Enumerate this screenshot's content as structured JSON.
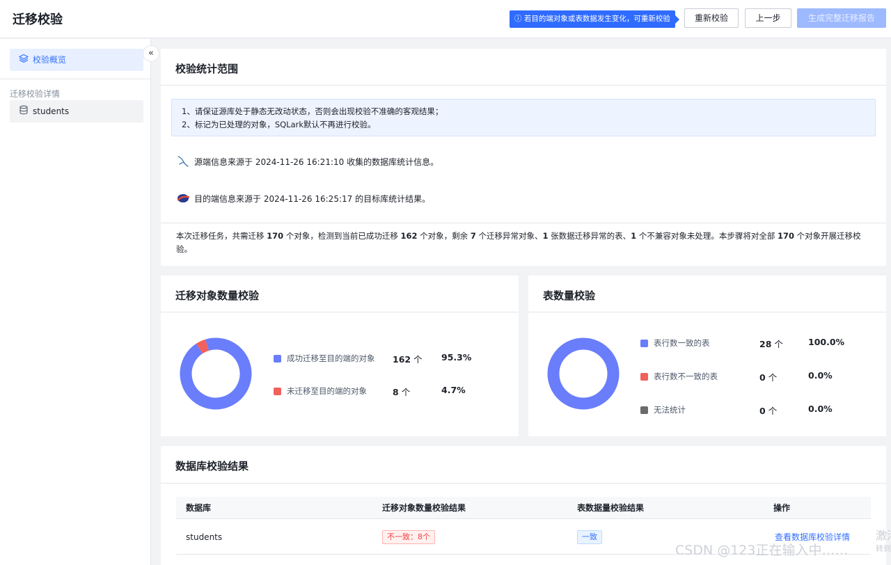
{
  "header": {
    "title": "迁移校验",
    "tip": "ⓘ 若目的端对象或表数据发生变化，可重新校验",
    "recheck_label": "重新校验",
    "prev_label": "上一步",
    "report_label": "生成完整迁移报告"
  },
  "sidebar": {
    "overview_label": "校验概览",
    "group_label": "迁移校验详情",
    "items": [
      {
        "label": "students"
      }
    ]
  },
  "scope": {
    "title": "校验统计范围",
    "notice_lines": [
      "1、请保证源库处于静态无改动状态，否则会出现校验不准确的客观结果；",
      "2、标记为已处理的对象，SQLark默认不再进行校验。"
    ],
    "source_info": "源端信息来源于 2024-11-26 16:21:10 收集的数据库统计信息。",
    "target_info": "目的端信息来源于 2024-11-26 16:25:17 的目标库统计结果。",
    "summary": {
      "p1": "本次迁移任务，共需迁移 ",
      "n1": "170",
      "p2": " 个对象，检测到当前已成功迁移 ",
      "n2": "162",
      "p3": " 个对象，剩余 ",
      "n3": "7",
      "p4": " 个迁移异常对象、",
      "n4": "1",
      "p5": " 张数据迁移异常的表、",
      "n5": "1",
      "p6": " 个不兼容对象未处理。本步骤将对全部 ",
      "n6": "170",
      "p7": " 个对象开展迁移校验。"
    }
  },
  "object_check": {
    "title": "迁移对象数量校验",
    "unit": "个",
    "chart_data": {
      "type": "pie",
      "series": [
        {
          "name": "成功迁移至目的端的对象",
          "count": 162,
          "percent": "95.3%",
          "value": 162,
          "color": "#6a7dfb"
        },
        {
          "name": "未迁移至目的端的对象",
          "count": 8,
          "percent": "4.7%",
          "value": 8,
          "color": "#f0605d"
        }
      ]
    }
  },
  "table_check": {
    "title": "表数量校验",
    "unit": "个",
    "chart_data": {
      "type": "pie",
      "series": [
        {
          "name": "表行数一致的表",
          "count": 28,
          "percent": "100.0%",
          "value": 28,
          "color": "#6a7dfb"
        },
        {
          "name": "表行数不一致的表",
          "count": 0,
          "percent": "0.0%",
          "value": 0,
          "color": "#f0605d"
        },
        {
          "name": "无法统计",
          "count": 0,
          "percent": "0.0%",
          "value": 0,
          "color": "#6b6b6b"
        }
      ]
    }
  },
  "db_result": {
    "title": "数据库校验结果",
    "columns": [
      "数据库",
      "迁移对象数量校验结果",
      "表数据量校验结果",
      "操作"
    ],
    "rows": [
      {
        "db": "students",
        "object_result": "不一致：8个",
        "data_result": "一致",
        "action": "查看数据库校验详情"
      }
    ]
  },
  "watermark": "CSDN @123正在输入中……",
  "activate_text": "激活",
  "activate_sub": "转到"
}
